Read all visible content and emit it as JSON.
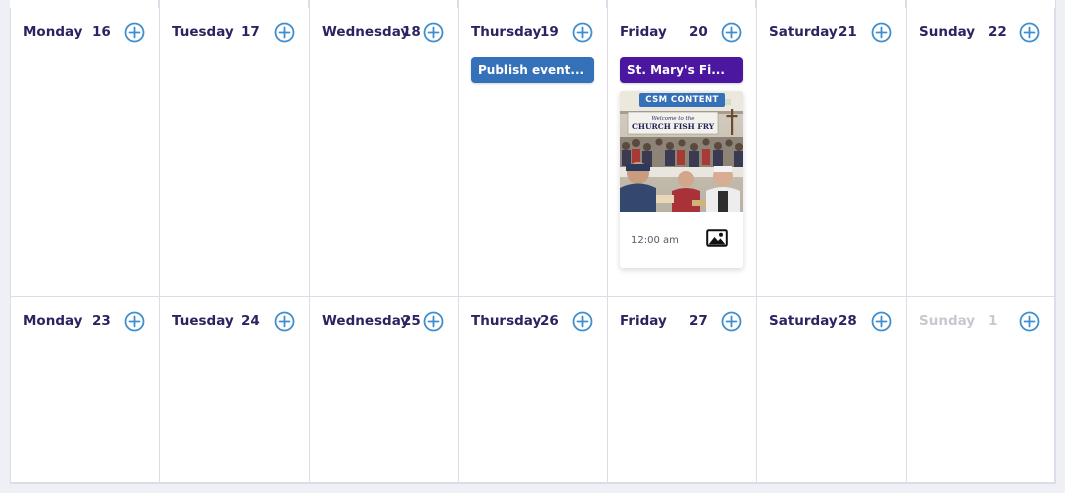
{
  "colors": {
    "day_text": "#2c2360",
    "muted_day_text": "#c7c8d0",
    "add_icon": "#3f8fcf",
    "border": "#dcdde6",
    "event_blue": "#3571b8",
    "event_purple": "#4b17a0",
    "page_bg": "#eef0f5"
  },
  "weeks": [
    {
      "days": [
        {
          "name": "Monday",
          "number": "16"
        },
        {
          "name": "Tuesday",
          "number": "17"
        },
        {
          "name": "Wednesday",
          "number": "18"
        },
        {
          "name": "Thursday",
          "number": "19"
        },
        {
          "name": "Friday",
          "number": "20"
        },
        {
          "name": "Saturday",
          "number": "21"
        },
        {
          "name": "Sunday",
          "number": "22"
        }
      ]
    },
    {
      "days": [
        {
          "name": "Monday",
          "number": "23"
        },
        {
          "name": "Tuesday",
          "number": "24"
        },
        {
          "name": "Wednesday",
          "number": "25"
        },
        {
          "name": "Thursday",
          "number": "26"
        },
        {
          "name": "Friday",
          "number": "27"
        },
        {
          "name": "Saturday",
          "number": "28"
        },
        {
          "name": "Sunday",
          "number": "1",
          "muted": true
        }
      ]
    }
  ],
  "events": {
    "thursday_19": {
      "label": "Publish event...",
      "color": "#3571b8"
    },
    "friday_20": {
      "label": "St. Mary's Fi...",
      "color": "#4b17a0"
    }
  },
  "post": {
    "badge": "CSM CONTENT",
    "banner_line1": "Welcome to the",
    "banner_line2": "CHURCH FISH FRY",
    "time": "12:00 am",
    "media_type": "image-icon"
  },
  "icons": {
    "add": "plus-circle-icon",
    "media": "image-icon"
  }
}
